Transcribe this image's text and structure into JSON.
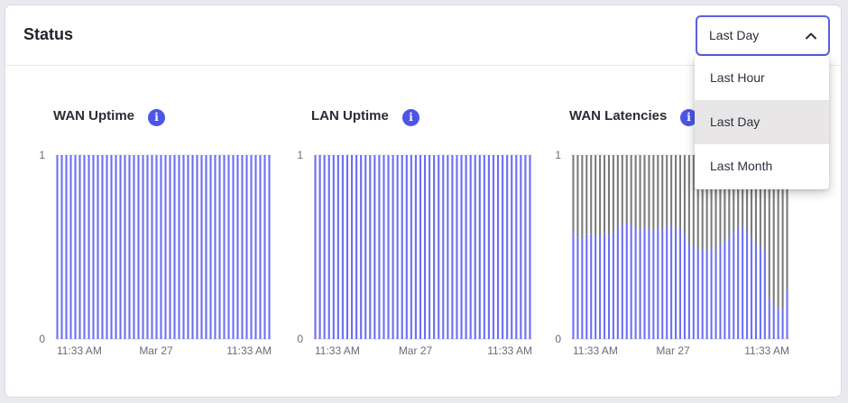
{
  "header": {
    "title": "Status"
  },
  "range_select": {
    "value": "Last Day",
    "options": [
      "Last Hour",
      "Last Day",
      "Last Month"
    ],
    "selected_index": 1
  },
  "colors": {
    "accent": "#5a5fe0",
    "bar": "#6c6ff2",
    "latency_gap": "#7a7a7a"
  },
  "icons": {
    "info": "info-icon",
    "chevron": "chevron-up-icon"
  },
  "panels": [
    {
      "title": "WAN Uptime",
      "info_symbol": "i"
    },
    {
      "title": "LAN Uptime",
      "info_symbol": "i"
    },
    {
      "title": "WAN Latencies",
      "info_symbol": "i"
    }
  ],
  "chart_data": [
    {
      "type": "bar",
      "title": "WAN Uptime",
      "y_ticks": [
        "1",
        "0"
      ],
      "ylim": [
        0,
        1
      ],
      "x_ticks": [
        "11:33 AM",
        "Mar 27",
        "11:33 AM"
      ],
      "values": [
        1,
        1,
        1,
        1,
        1,
        1,
        1,
        1,
        1,
        1,
        1,
        1,
        1,
        1,
        1,
        1,
        1,
        1,
        1,
        1,
        1,
        1,
        1,
        1,
        1,
        1,
        1,
        1,
        1,
        1,
        1,
        1,
        1,
        1,
        1,
        1,
        1,
        1,
        1,
        1,
        1,
        1,
        1,
        1,
        1,
        1,
        1,
        1
      ]
    },
    {
      "type": "bar",
      "title": "LAN Uptime",
      "y_ticks": [
        "1",
        "0"
      ],
      "ylim": [
        0,
        1
      ],
      "x_ticks": [
        "11:33 AM",
        "Mar 27",
        "11:33 AM"
      ],
      "values": [
        1,
        1,
        1,
        1,
        1,
        1,
        1,
        1,
        1,
        1,
        1,
        1,
        1,
        1,
        1,
        1,
        1,
        1,
        1,
        1,
        1,
        1,
        1,
        1,
        1,
        1,
        1,
        1,
        1,
        1,
        1,
        1,
        1,
        1,
        1,
        1,
        1,
        1,
        1,
        1,
        1,
        1,
        1,
        1,
        1,
        1,
        1,
        1
      ]
    },
    {
      "type": "bar",
      "title": "WAN Latencies",
      "y_ticks": [
        "1",
        "0"
      ],
      "ylim": [
        0,
        1
      ],
      "x_ticks": [
        "11:33 AM",
        "Mar 27",
        "11:33 AM"
      ],
      "values": [
        0.58,
        0.55,
        0.54,
        0.57,
        0.57,
        0.56,
        0.55,
        0.58,
        0.56,
        0.58,
        0.62,
        0.61,
        0.63,
        0.62,
        0.6,
        0.59,
        0.61,
        0.6,
        0.59,
        0.61,
        0.59,
        0.62,
        0.61,
        0.6,
        0.6,
        0.56,
        0.52,
        0.51,
        0.48,
        0.49,
        0.48,
        0.49,
        0.5,
        0.51,
        0.53,
        0.55,
        0.59,
        0.6,
        0.61,
        0.59,
        0.55,
        0.52,
        0.5,
        0.48,
        0.22,
        0.18,
        0.17,
        0.16,
        0.27
      ]
    }
  ]
}
